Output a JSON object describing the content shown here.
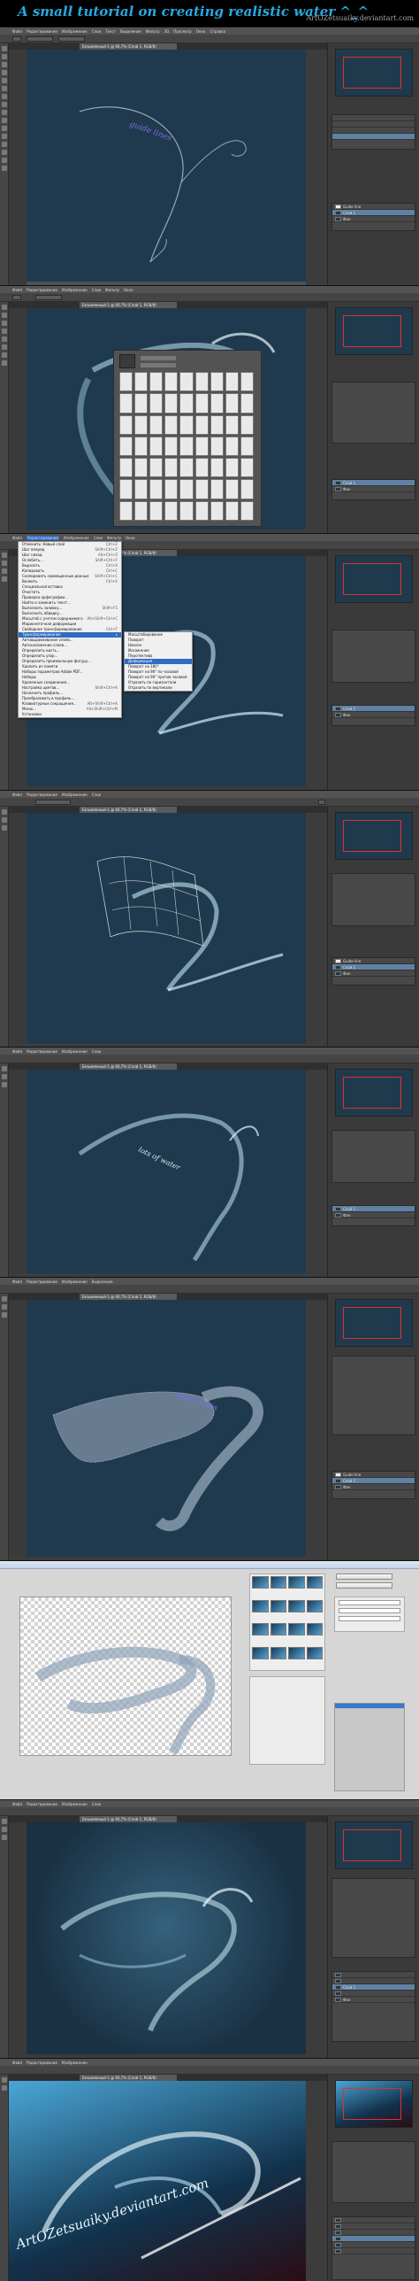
{
  "header": {
    "title": "A small tutorial on creating realistic water ^_^",
    "credit": "ArtOZetsuaiky.deviantart.com"
  },
  "menubar": {
    "items": [
      "Файл",
      "Редактирование",
      "Изображение",
      "Слои",
      "Текст",
      "Выделение",
      "Фильтр",
      "3D",
      "Просмотр",
      "Окно",
      "Справка"
    ]
  },
  "doc_tab": "Безымянный-1 @ 66,7% (Слой 1, RGB/8)",
  "layers": {
    "water_layer": "Слой 1",
    "path_text": "Guide line",
    "background": "Фон"
  },
  "canvas_texts": {
    "guide_lines": "guide lines",
    "lots_of_water": "lots of water",
    "watermark": "ArtOZetsuaiky.deviantart.com"
  },
  "edit_menu": [
    {
      "label": "Отменить: Новый слой",
      "shortcut": "Ctrl+Z"
    },
    {
      "label": "Шаг вперед",
      "shortcut": "Shift+Ctrl+Z"
    },
    {
      "label": "Шаг назад",
      "shortcut": "Alt+Ctrl+Z"
    },
    {
      "label": "Ослабить...",
      "shortcut": "Shift+Ctrl+F"
    },
    {
      "label": "Вырезать",
      "shortcut": "Ctrl+X"
    },
    {
      "label": "Копировать",
      "shortcut": "Ctrl+C"
    },
    {
      "label": "Скопировать совмещенные данные",
      "shortcut": "Shift+Ctrl+C"
    },
    {
      "label": "Вклеить",
      "shortcut": "Ctrl+V"
    },
    {
      "label": "Специальная вставка",
      "shortcut": ""
    },
    {
      "label": "Очистить",
      "shortcut": ""
    },
    {
      "label": "Проверка орфографии...",
      "shortcut": ""
    },
    {
      "label": "Найти и заменить текст...",
      "shortcut": ""
    },
    {
      "label": "Выполнить заливку...",
      "shortcut": "Shift+F5"
    },
    {
      "label": "Выполнить обводку...",
      "shortcut": ""
    },
    {
      "label": "Масштаб с учетом содержимого",
      "shortcut": "Alt+Shift+Ctrl+C"
    },
    {
      "label": "Марионеточная деформация",
      "shortcut": ""
    },
    {
      "label": "Свободное трансформирование",
      "shortcut": "Ctrl+T"
    },
    {
      "label": "Трансформирование",
      "shortcut": ""
    },
    {
      "label": "Автовыравнивание слоев...",
      "shortcut": ""
    },
    {
      "label": "Автоналожение слоев...",
      "shortcut": ""
    },
    {
      "label": "Определить кисть...",
      "shortcut": ""
    },
    {
      "label": "Определить узор...",
      "shortcut": ""
    },
    {
      "label": "Определить произвольную фигуру...",
      "shortcut": ""
    },
    {
      "label": "Удалить из памяти",
      "shortcut": ""
    },
    {
      "label": "Наборы параметров Adobe PDF...",
      "shortcut": ""
    },
    {
      "label": "Наборы",
      "shortcut": ""
    },
    {
      "label": "Удаленные соединения...",
      "shortcut": ""
    },
    {
      "label": "Настройка цветов...",
      "shortcut": "Shift+Ctrl+K"
    },
    {
      "label": "Назначить профиль...",
      "shortcut": ""
    },
    {
      "label": "Преобразовать в профиль...",
      "shortcut": ""
    },
    {
      "label": "Клавиатурные сокращения...",
      "shortcut": "Alt+Shift+Ctrl+K"
    },
    {
      "label": "Меню...",
      "shortcut": "Alt+Shift+Ctrl+M"
    },
    {
      "label": "Установки",
      "shortcut": ""
    }
  ],
  "edit_menu_highlighted": 17,
  "transform_menu": [
    {
      "label": "Масштабирование"
    },
    {
      "label": "Поворот"
    },
    {
      "label": "Наклон"
    },
    {
      "label": "Искажение"
    },
    {
      "label": "Перспектива"
    },
    {
      "label": "Деформация"
    },
    {
      "label": "Поворот на 180°"
    },
    {
      "label": "Поворот на 90° по часовой"
    },
    {
      "label": "Поворот на 90° против часовой"
    },
    {
      "label": "Отразить по горизонтали"
    },
    {
      "label": "Отразить по вертикали"
    }
  ],
  "transform_menu_highlighted": 5,
  "colors": {
    "canvas": "#1f3a4e",
    "title": "#29a8e0",
    "selection": "#5f81a5",
    "path_text": "#7c6fe0"
  }
}
